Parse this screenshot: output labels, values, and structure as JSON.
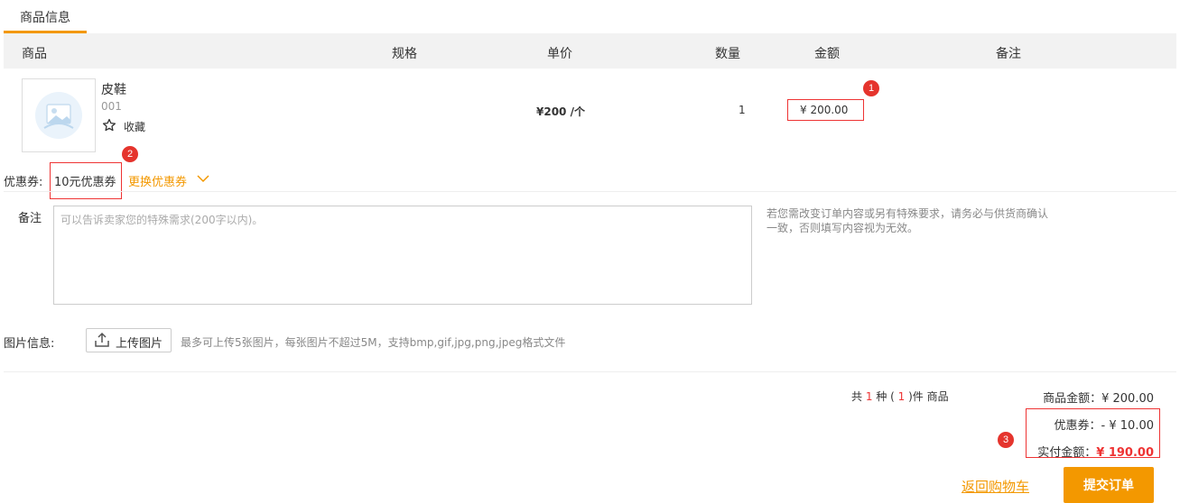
{
  "tab": {
    "label": "商品信息"
  },
  "table": {
    "headers": [
      "商品",
      "规格",
      "单价",
      "数量",
      "金额",
      "备注"
    ]
  },
  "product": {
    "name": "皮鞋",
    "sku": "001",
    "favorite_label": "收藏",
    "unit_price": "¥200 /个",
    "quantity": "1",
    "amount": "¥ 200.00"
  },
  "badges": [
    "1",
    "2",
    "3"
  ],
  "coupon": {
    "label": "优惠券:",
    "value": "10元优惠券",
    "change_label": "更换优惠券"
  },
  "remark": {
    "label": "备注",
    "placeholder": "可以告诉卖家您的特殊需求(200字以内)。",
    "tip": "若您需改变订单内容或另有特殊要求，请务必与供货商确认一致，否则填写内容视为无效。"
  },
  "images": {
    "label": "图片信息:",
    "upload_label": "上传图片",
    "tip": "最多可上传5张图片，每张图片不超过5M，支持bmp,gif,jpg,png,jpeg格式文件"
  },
  "summary": {
    "count_prefix": "共",
    "kinds": "1",
    "kinds_unit": "种 (",
    "items": "1",
    "items_unit": ")件 商品",
    "goods_amount_label": "商品金额：",
    "goods_amount": "¥ 200.00",
    "coupon_label": "优惠券：-",
    "coupon_amount": "¥ 10.00",
    "paid_label": "实付金额：",
    "paid_amount": "¥ 190.00"
  },
  "actions": {
    "back_label": "返回购物车",
    "submit_label": "提交订单"
  },
  "colors": {
    "accent": "#f39800",
    "highlight": "#e33"
  }
}
